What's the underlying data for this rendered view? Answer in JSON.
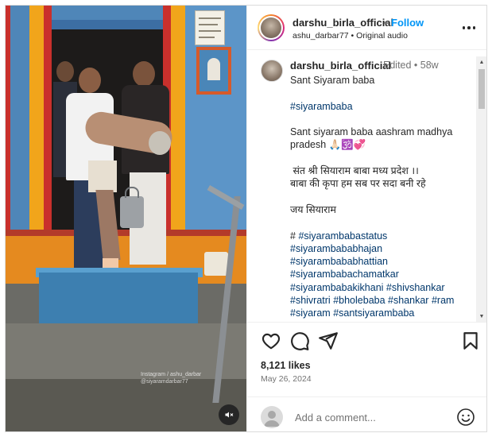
{
  "post": {
    "username": "darshu_birla_official",
    "separator": "•",
    "follow_label": "Follow",
    "audio_line": "ashu_darbar77 • Original audio"
  },
  "media": {
    "watermark": "Instagram / ashu_darbar\n@siyaramdarbar77",
    "mute_icon": "speaker-muted-icon"
  },
  "caption": {
    "username": "darshu_birla_official",
    "edited_age": "Edited • 58w",
    "lines": [
      "Sant Siyaram baba",
      "",
      "#siyarambaba",
      "",
      "Sant siyaram baba aashram madhya pradesh 🙏🏻🕉️💞",
      "",
      " संत श्री सियाराम बाबा मध्य प्रदेश ।।",
      "बाबा की कृपा हम सब पर सदा बनी रहे",
      "",
      "जय सियाराम",
      "",
      "# #siyarambabastatus",
      "#siyarambababhajan",
      "#siyarambababhattian",
      "#siyarambabachamatkar",
      "#siyarambabakikhani #shivshankar",
      "#shivratri #bholebaba #shankar #ram",
      "#siyaram #santsiyarambaba"
    ]
  },
  "engagement": {
    "likes": "8,121 likes",
    "date": "May 26, 2024"
  },
  "comment": {
    "placeholder": "Add a comment..."
  },
  "colors": {
    "link_blue": "#0095f6",
    "hashtag": "#00376b",
    "text": "#262626",
    "muted": "#737373"
  }
}
